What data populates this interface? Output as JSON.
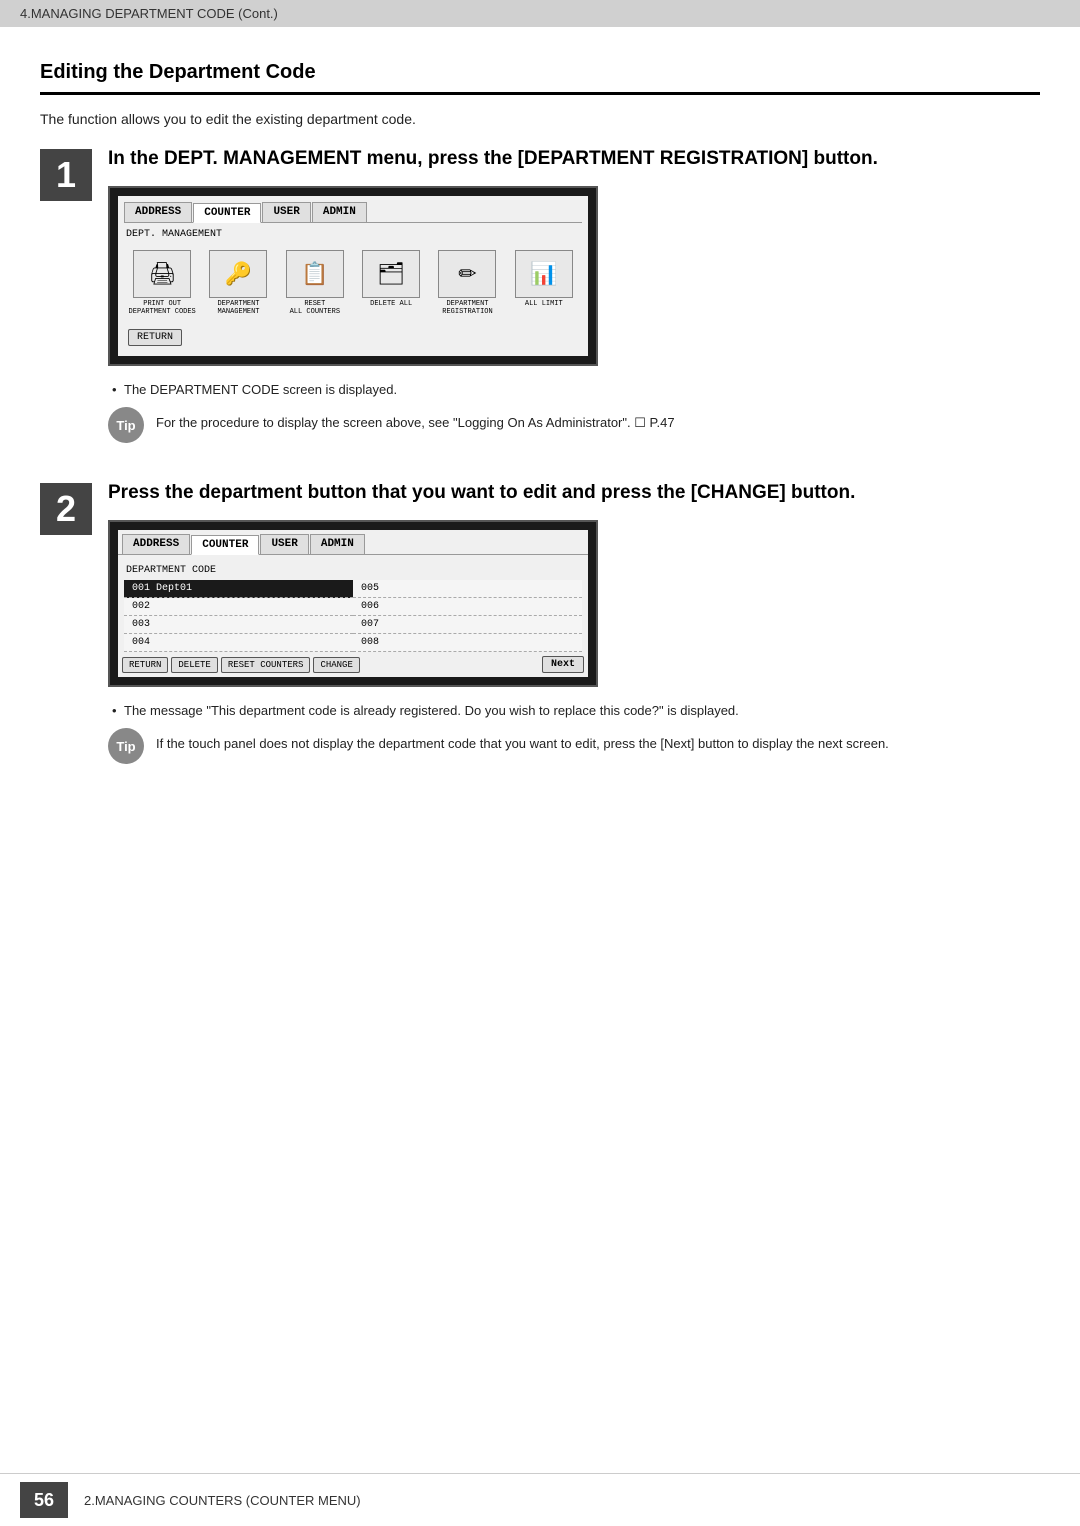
{
  "header": {
    "top_label": "4.MANAGING DEPARTMENT CODE (Cont.)"
  },
  "section": {
    "title": "Editing the Department Code",
    "description": "The function allows you to edit the existing department code."
  },
  "steps": [
    {
      "number": "1",
      "title": "In the DEPT. MANAGEMENT menu, press the [DEPARTMENT REGISTRATION] button.",
      "screen1": {
        "tabs": [
          "ADDRESS",
          "COUNTER",
          "USER",
          "ADMIN"
        ],
        "active_tab": "COUNTER",
        "label": "DEPT. MANAGEMENT",
        "icons": [
          {
            "label": "PRINT OUT\nDEPARTMENT CODES",
            "symbol": "🖨"
          },
          {
            "label": "DEPARTMENT\nMANAGEMENT",
            "symbol": "🔑"
          },
          {
            "label": "RESET\nALL COUNTERS",
            "symbol": "📋"
          },
          {
            "label": "DELETE ALL",
            "symbol": "🗂"
          },
          {
            "label": "DEPARTMENT\nREGISTRATION",
            "symbol": "✏"
          },
          {
            "label": "ALL LIMIT",
            "symbol": "📊"
          }
        ],
        "return_btn": "RETURN"
      },
      "bullet": "The DEPARTMENT CODE screen is displayed.",
      "tip": {
        "label": "Tip",
        "text": "For the procedure to display the screen above, see \"Logging On As Administrator\".  ☐ P.47"
      }
    },
    {
      "number": "2",
      "title": "Press the department button that you want to edit and press the [CHANGE] button.",
      "screen2": {
        "tabs": [
          "ADDRESS",
          "COUNTER",
          "USER",
          "ADMIN"
        ],
        "active_tab": "COUNTER",
        "label": "DEPARTMENT CODE",
        "rows": [
          {
            "left": "001 Dept01",
            "right": "005",
            "selected_left": true
          },
          {
            "left": "002",
            "right": "006",
            "selected_left": false
          },
          {
            "left": "003",
            "right": "007",
            "selected_left": false
          },
          {
            "left": "004",
            "right": "008",
            "selected_left": false
          }
        ],
        "buttons": [
          "RETURN",
          "DELETE",
          "RESET COUNTERS",
          "CHANGE"
        ],
        "next_btn": "Next"
      },
      "bullet": "The message \"This department code is already registered.  Do you wish to replace this code?\" is displayed.",
      "tip": {
        "label": "Tip",
        "text": "If the touch panel does not display the department code that you want to edit, press the [Next] button to display the next screen."
      }
    }
  ],
  "footer": {
    "page_number": "56",
    "text": "2.MANAGING COUNTERS (COUNTER MENU)"
  }
}
